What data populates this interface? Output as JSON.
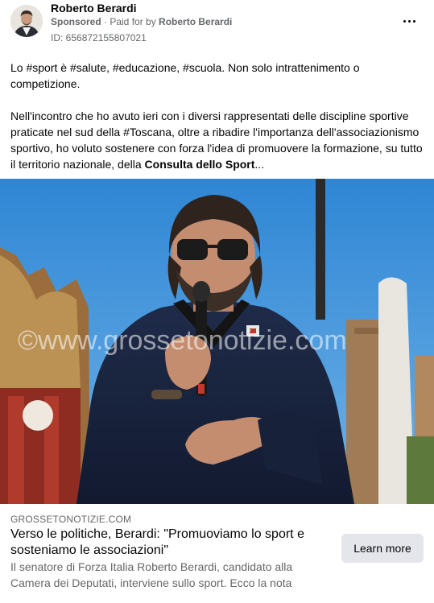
{
  "post": {
    "author": "Roberto Berardi",
    "sponsored_label": "Sponsored",
    "paid_prefix": " · Paid for by ",
    "paid_by": "Roberto Berardi",
    "ad_id": "ID: 656872155807021"
  },
  "body": {
    "paragraph1": "Lo #sport è #salute, #educazione, #scuola. Non solo intrattenimento o competizione.",
    "paragraph2_text": "Nell'incontro che ho avuto ieri con i diversi rappresentati delle discipline sportive praticate nel sud della #Toscana, oltre a ribadire l'importanza dell'associazionismo sportivo, ho voluto sostenere con forza l'idea di promuovere la formazione, su tutto il territorio nazionale, della ",
    "paragraph2_bold": "Consulta dello Sport",
    "ellipsis": "..."
  },
  "image": {
    "watermark": "©www.grossetonotizie.com"
  },
  "link": {
    "domain": "GROSSETONOTIZIE.COM",
    "headline": "Verso le politiche, Berardi: \"Promuoviamo lo sport e sosteniamo le associazioni\"",
    "description": "Il senatore di Forza Italia Roberto Berardi, candidato alla Camera dei Deputati, interviene sullo sport. Ecco la nota",
    "cta": "Learn more"
  },
  "colors": {
    "text_primary": "#050505",
    "text_secondary": "#65676b",
    "button_bg": "#e4e6eb",
    "sky": "#3d8fd6"
  },
  "icons": {
    "more": "more-horizontal-icon",
    "avatar": "avatar"
  }
}
